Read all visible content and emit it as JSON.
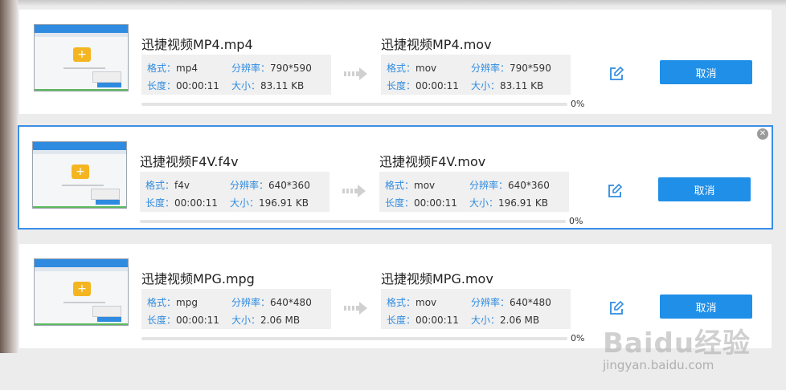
{
  "tasks": [
    {
      "source": {
        "name": "迅捷视频MP4.mp4",
        "format_label": "格式：",
        "format": "mp4",
        "res_label": "分辨率：",
        "resolution": "790*590",
        "duration_label": "长度：",
        "duration": "00:00:11",
        "size_label": "大小：",
        "size": "83.11 KB"
      },
      "target": {
        "name": "迅捷视频MP4.mov",
        "format_label": "格式：",
        "format": "mov",
        "res_label": "分辨率：",
        "resolution": "790*590",
        "duration_label": "长度：",
        "duration": "00:00:11",
        "size_label": "大小：",
        "size": "83.11 KB"
      },
      "progress": 0,
      "progress_text": "0%",
      "cancel_label": "取消",
      "selected": false
    },
    {
      "source": {
        "name": "迅捷视频F4V.f4v",
        "format_label": "格式：",
        "format": "f4v",
        "res_label": "分辨率：",
        "resolution": "640*360",
        "duration_label": "长度：",
        "duration": "00:00:11",
        "size_label": "大小：",
        "size": "196.91 KB"
      },
      "target": {
        "name": "迅捷视频F4V.mov",
        "format_label": "格式：",
        "format": "mov",
        "res_label": "分辨率：",
        "resolution": "640*360",
        "duration_label": "长度：",
        "duration": "00:00:11",
        "size_label": "大小：",
        "size": "196.91 KB"
      },
      "progress": 0,
      "progress_text": "0%",
      "cancel_label": "取消",
      "selected": true
    },
    {
      "source": {
        "name": "迅捷视频MPG.mpg",
        "format_label": "格式：",
        "format": "mpg",
        "res_label": "分辨率：",
        "resolution": "640*480",
        "duration_label": "长度：",
        "duration": "00:00:11",
        "size_label": "大小：",
        "size": "2.06 MB"
      },
      "target": {
        "name": "迅捷视频MPG.mov",
        "format_label": "格式：",
        "format": "mov",
        "res_label": "分辨率：",
        "resolution": "640*480",
        "duration_label": "长度：",
        "duration": "00:00:11",
        "size_label": "大小：",
        "size": "2.06 MB"
      },
      "progress": 0,
      "progress_text": "0%",
      "cancel_label": "取消",
      "selected": false
    }
  ],
  "icons": {
    "arrow": "arrow-right-icon",
    "edit": "edit-icon",
    "close": "close-icon",
    "folder": "folder-plus-icon"
  },
  "colors": {
    "accent": "#1f8fe8",
    "label": "#2f8be0",
    "selected_border": "#3a8ee6"
  },
  "watermark": {
    "line1": "Baidu经验",
    "line2": "jingyan.baidu.com"
  }
}
